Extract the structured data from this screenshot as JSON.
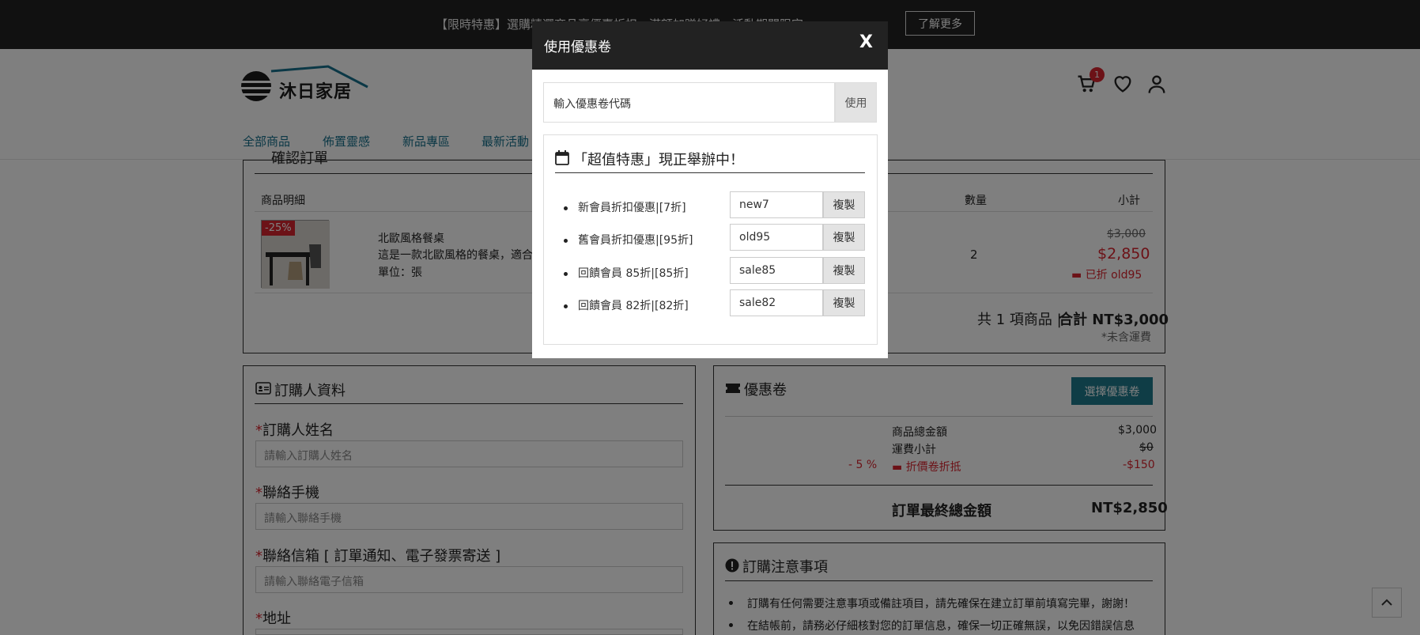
{
  "topbar": {
    "promo_text": "【限時特惠】選購精選商品享優惠折扣，滿額加贈好禮，活動期間限定",
    "more_label": "了解更多"
  },
  "header": {
    "logo_text": "沐日家居",
    "nav": [
      "全部商品",
      "佈置靈感",
      "新品專區",
      "最新活動"
    ],
    "cart_count": "1"
  },
  "order": {
    "section_title": "確認訂單",
    "col_detail": "商品明細",
    "col_qty": "數量",
    "col_subtotal": "小計",
    "item": {
      "discount_badge": "-25%",
      "name": "北歐風格餐桌",
      "desc": "這是一款北歐風格的餐桌，適合",
      "unit": "單位：張",
      "qty": "2",
      "orig_price": "$3,000",
      "price": "$2,850",
      "applied": "已折 old95"
    },
    "summary_count": "共 1 項商品 | ",
    "summary_total": "合計 NT$3,000",
    "shipping_note": "*未含運費"
  },
  "buyer": {
    "section_title": "訂購人資料",
    "fields": [
      {
        "label": "訂購人姓名",
        "placeholder": "請輸入訂購人姓名"
      },
      {
        "label": "聯絡手機",
        "placeholder": "請輸入聯絡手機"
      },
      {
        "label": "聯絡信箱 [ 訂單通知、電子發票寄送 ]",
        "placeholder": "請輸入聯絡電子信箱"
      },
      {
        "label": "地址",
        "placeholder": ""
      }
    ]
  },
  "coupon": {
    "section_title": "優惠卷",
    "select_btn": "選擇優惠卷",
    "goods_total_label": "商品總金額",
    "goods_total": "$3,000",
    "shipping_label": "運費小計",
    "shipping": "$0",
    "discount_pct": "- 5 %",
    "discount_label": "折價卷折抵",
    "discount": "-$150",
    "final_label": "訂單最終總金額",
    "final": "NT$2,850"
  },
  "notice": {
    "section_title": "訂購注意事項",
    "items": [
      "訂購有任何需要注意事項或備註項目，請先確保在建立訂單前填寫完畢，謝謝！",
      "在結帳前，請務必仔細核對您的訂單信息，確保一切正確無誤，以免因錯誤信息"
    ]
  },
  "modal": {
    "title": "使用優惠卷",
    "close": "X",
    "input_value": "輸入優惠卷代碼",
    "use_btn": "使用",
    "promo_title": "「超值特惠」現正舉辦中！",
    "promos": [
      {
        "label": "新會員折扣優惠|[7折]",
        "code": "new7",
        "copy": "複製"
      },
      {
        "label": "舊會員折扣優惠|[95折]",
        "code": "old95",
        "copy": "複製"
      },
      {
        "label": "回饋會員 85折|[85折]",
        "code": "sale85",
        "copy": "複製"
      },
      {
        "label": "回饋會員 82折|[82折]",
        "code": "sale82",
        "copy": "複製"
      }
    ]
  },
  "colors": {
    "accent": "#1f7a8c",
    "danger": "#d9252f",
    "dark": "#222222"
  }
}
